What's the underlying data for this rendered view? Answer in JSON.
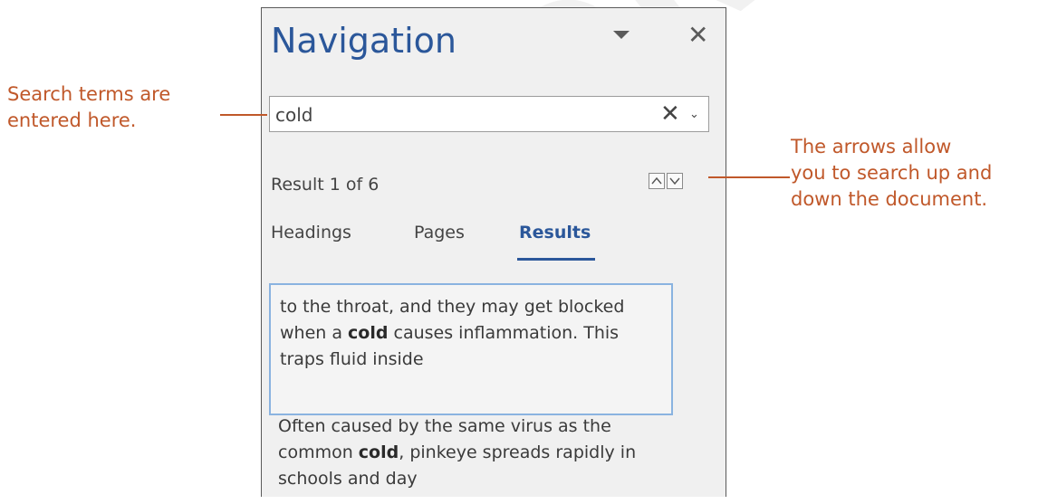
{
  "watermark": "TION ONLY",
  "pane": {
    "title": "Navigation",
    "menu_icon": "caret-down-icon",
    "close_icon": "close-icon",
    "close_glyph": "✕"
  },
  "search": {
    "value": "cold",
    "clear_glyph": "✕",
    "options_glyph": "⌄"
  },
  "results": {
    "count_text": "Result 1 of 6",
    "prev_icon": "chevron-up-icon",
    "next_icon": "chevron-down-icon"
  },
  "tabs": [
    {
      "label": "Headings",
      "active": false
    },
    {
      "label": "Pages",
      "active": false
    },
    {
      "label": "Results",
      "active": true
    }
  ],
  "items": [
    {
      "before": "to the throat, and they may get blocked when a ",
      "match": "cold",
      "after": " causes inflammation. This traps fluid inside"
    },
    {
      "before": "Often caused by the same virus as the common ",
      "match": "cold",
      "after": ", pinkeye spreads rapidly in schools and day"
    }
  ],
  "callouts": {
    "search_box": [
      "Search terms are",
      "entered here."
    ],
    "arrows": [
      "The arrows allow",
      "you to search up and",
      "down the document."
    ]
  },
  "colors": {
    "title_blue": "#2b579a",
    "callout_orange": "#c0582a",
    "selected_border": "#8ab3e0"
  }
}
